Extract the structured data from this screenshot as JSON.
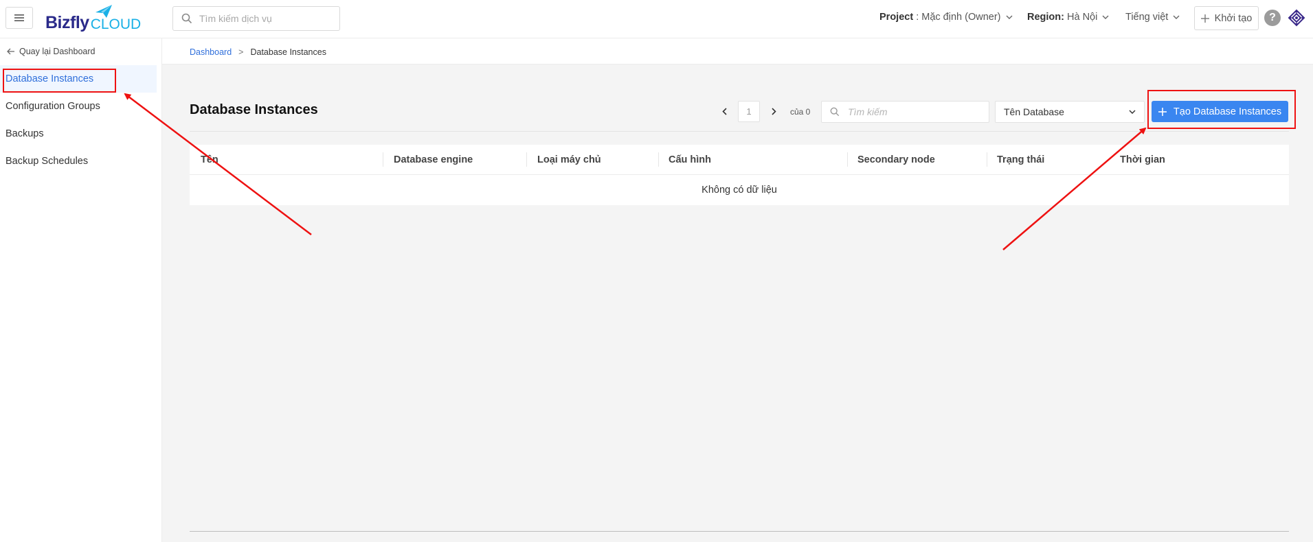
{
  "header": {
    "logo_main": "Bizfly",
    "logo_accent": "CLOUD",
    "search_placeholder": "Tìm kiếm dịch vụ",
    "project_label": "Project",
    "project_value": ": Mặc định (Owner)",
    "region_label": "Region:",
    "region_value": "Hà Nội",
    "language": "Tiếng việt",
    "create_label": "Khởi tạo",
    "help_glyph": "?"
  },
  "sidebar": {
    "back_label": "Quay lại Dashboard",
    "items": [
      {
        "label": "Database Instances",
        "active": true
      },
      {
        "label": "Configuration Groups"
      },
      {
        "label": "Backups"
      },
      {
        "label": "Backup Schedules"
      }
    ]
  },
  "breadcrumb": {
    "root": "Dashboard",
    "separator": ">",
    "current": "Database Instances"
  },
  "main": {
    "title": "Database Instances",
    "pagination": {
      "page": "1",
      "of_label": "của 0"
    },
    "search_placeholder": "Tìm kiếm",
    "filter_value": "Tên Database",
    "create_button": "Tạo Database Instances",
    "table": {
      "columns": [
        "Tên",
        "Database engine",
        "Loại máy chủ",
        "Cấu hình",
        "Secondary node",
        "Trạng thái",
        "Thời gian"
      ],
      "empty_text": "Không có dữ liệu"
    }
  },
  "colors": {
    "accent": "#3a86f0",
    "brand_dark": "#2a2a8a",
    "brand_light": "#19b0e6",
    "annotation": "#ee1111"
  },
  "icons": [
    "menu-icon",
    "search-icon",
    "chevron-down-icon",
    "plus-icon",
    "help-icon",
    "apps-icon",
    "arrow-left-icon",
    "chevron-left-icon",
    "chevron-right-icon"
  ]
}
